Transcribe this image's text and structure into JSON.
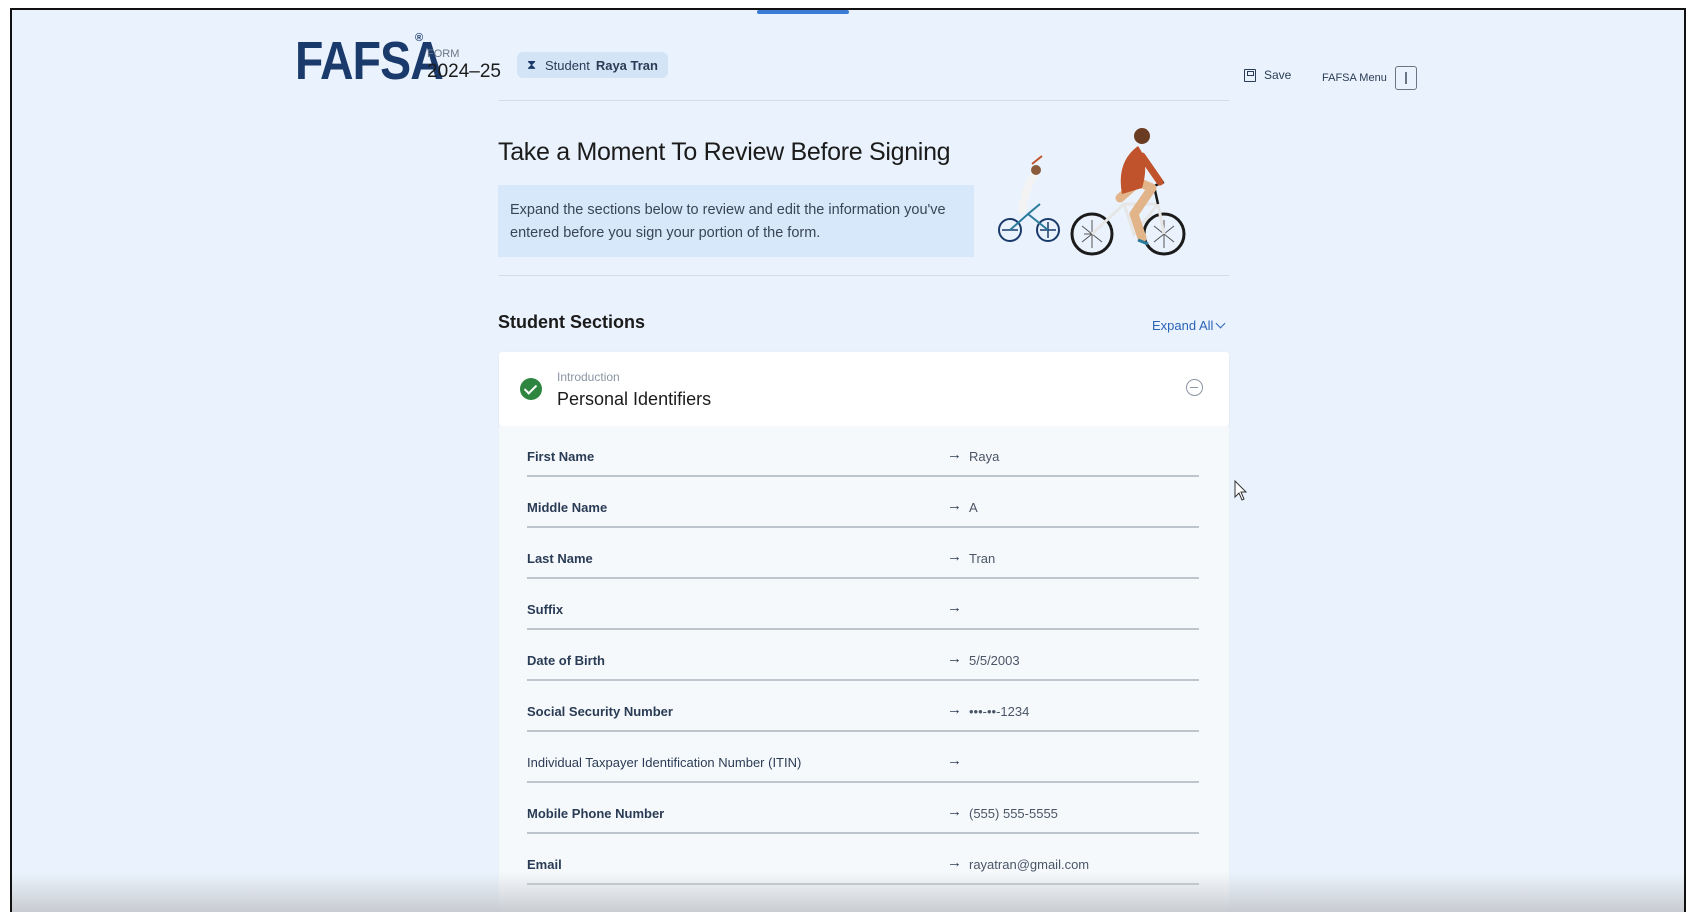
{
  "header": {
    "logo": "FAFSA",
    "logo_mark": "®",
    "form_label": "FORM",
    "form_year": "2024–25",
    "student_prefix": "Student",
    "student_name": "Raya Tran",
    "student_icon": "hourglass-icon",
    "save_label": "Save",
    "menu_label": "FAFSA Menu"
  },
  "hero": {
    "title": "Take a Moment To Review Before Signing",
    "note": "Expand the sections below to review and edit the information you've entered before you sign your portion of the form."
  },
  "sections": {
    "title": "Student Sections",
    "expand_all": "Expand All"
  },
  "accordion": {
    "overline": "Introduction",
    "title": "Personal Identifiers",
    "status_color": "#2e8540",
    "rows": [
      {
        "label": "First Name",
        "value": "Raya"
      },
      {
        "label": "Middle Name",
        "value": "A"
      },
      {
        "label": "Last Name",
        "value": "Tran"
      },
      {
        "label": "Suffix",
        "value": ""
      },
      {
        "label": "Date of Birth",
        "value": "5/5/2003"
      },
      {
        "label": "Social Security Number",
        "value": "•••-••-1234"
      },
      {
        "label": "Individual Taxpayer Identification Number (ITIN)",
        "value": ""
      },
      {
        "label": "Mobile Phone Number",
        "value": "(555) 555-5555"
      },
      {
        "label": "Email",
        "value": "rayatran@gmail.com"
      }
    ]
  },
  "colors": {
    "page_bg": "#eaf3fd",
    "brand": "#1a3a6b",
    "link": "#2a63b8",
    "note_bg": "#d6e8fa"
  }
}
